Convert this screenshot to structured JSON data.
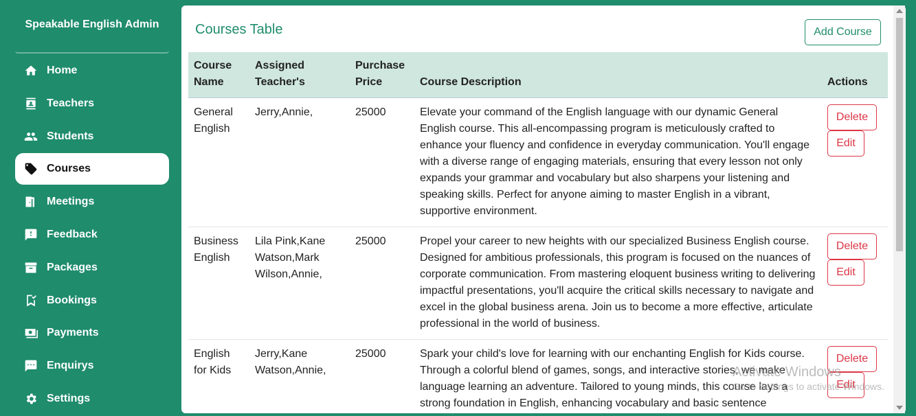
{
  "brand": "Speakable English Admin",
  "nav": [
    {
      "label": "Home",
      "icon": "home-icon"
    },
    {
      "label": "Teachers",
      "icon": "teacher-icon"
    },
    {
      "label": "Students",
      "icon": "students-icon"
    },
    {
      "label": "Courses",
      "icon": "tag-icon",
      "active": true
    },
    {
      "label": "Meetings",
      "icon": "door-icon"
    },
    {
      "label": "Feedback",
      "icon": "feedback-icon"
    },
    {
      "label": "Packages",
      "icon": "archive-icon"
    },
    {
      "label": "Bookings",
      "icon": "bookmark-check-icon"
    },
    {
      "label": "Payments",
      "icon": "payment-icon"
    },
    {
      "label": "Enquirys",
      "icon": "chat-icon"
    },
    {
      "label": "Settings",
      "icon": "gear-icon"
    }
  ],
  "page": {
    "title": "Courses Table",
    "add_button": "Add Course"
  },
  "table": {
    "headers": {
      "name": "Course Name",
      "teachers": "Assigned Teacher's",
      "price": "Purchase Price",
      "description": "Course Description",
      "actions": "Actions"
    },
    "delete_label": "Delete",
    "edit_label": "Edit",
    "rows": [
      {
        "name": "General English",
        "teachers": "Jerry,Annie,",
        "price": "25000",
        "description": "Elevate your command of the English language with our dynamic General English course. This all-encompassing program is meticulously crafted to enhance your fluency and confidence in everyday communication. You'll engage with a diverse range of engaging materials, ensuring that every lesson not only expands your grammar and vocabulary but also sharpens your listening and speaking skills. Perfect for anyone aiming to master English in a vibrant, supportive environment."
      },
      {
        "name": "Business English",
        "teachers": "Lila Pink,Kane Watson,Mark Wilson,Annie,",
        "price": "25000",
        "description": "Propel your career to new heights with our specialized Business English course. Designed for ambitious professionals, this program is focused on the nuances of corporate communication. From mastering eloquent business writing to delivering impactful presentations, you'll acquire the critical skills necessary to navigate and excel in the global business arena. Join us to become a more effective, articulate professional in the world of business."
      },
      {
        "name": "English for Kids",
        "teachers": "Jerry,Kane Watson,Annie,",
        "price": "25000",
        "description": "Spark your child's love for learning with our enchanting English for Kids course. Through a colorful blend of games, songs, and interactive stories, we make language learning an adventure. Tailored to young minds, this course lays a strong foundation in English, enhancing vocabulary and basic sentence construction in a joyful, nurturing environment. Watch your child's confidence and"
      }
    ]
  },
  "watermark": {
    "title": "Activate Windows",
    "subtitle": "Go to Settings to activate Windows."
  },
  "colors": {
    "brand_green": "#1f8c6c",
    "header_bg": "#cfe7df",
    "danger": "#dc3545"
  }
}
